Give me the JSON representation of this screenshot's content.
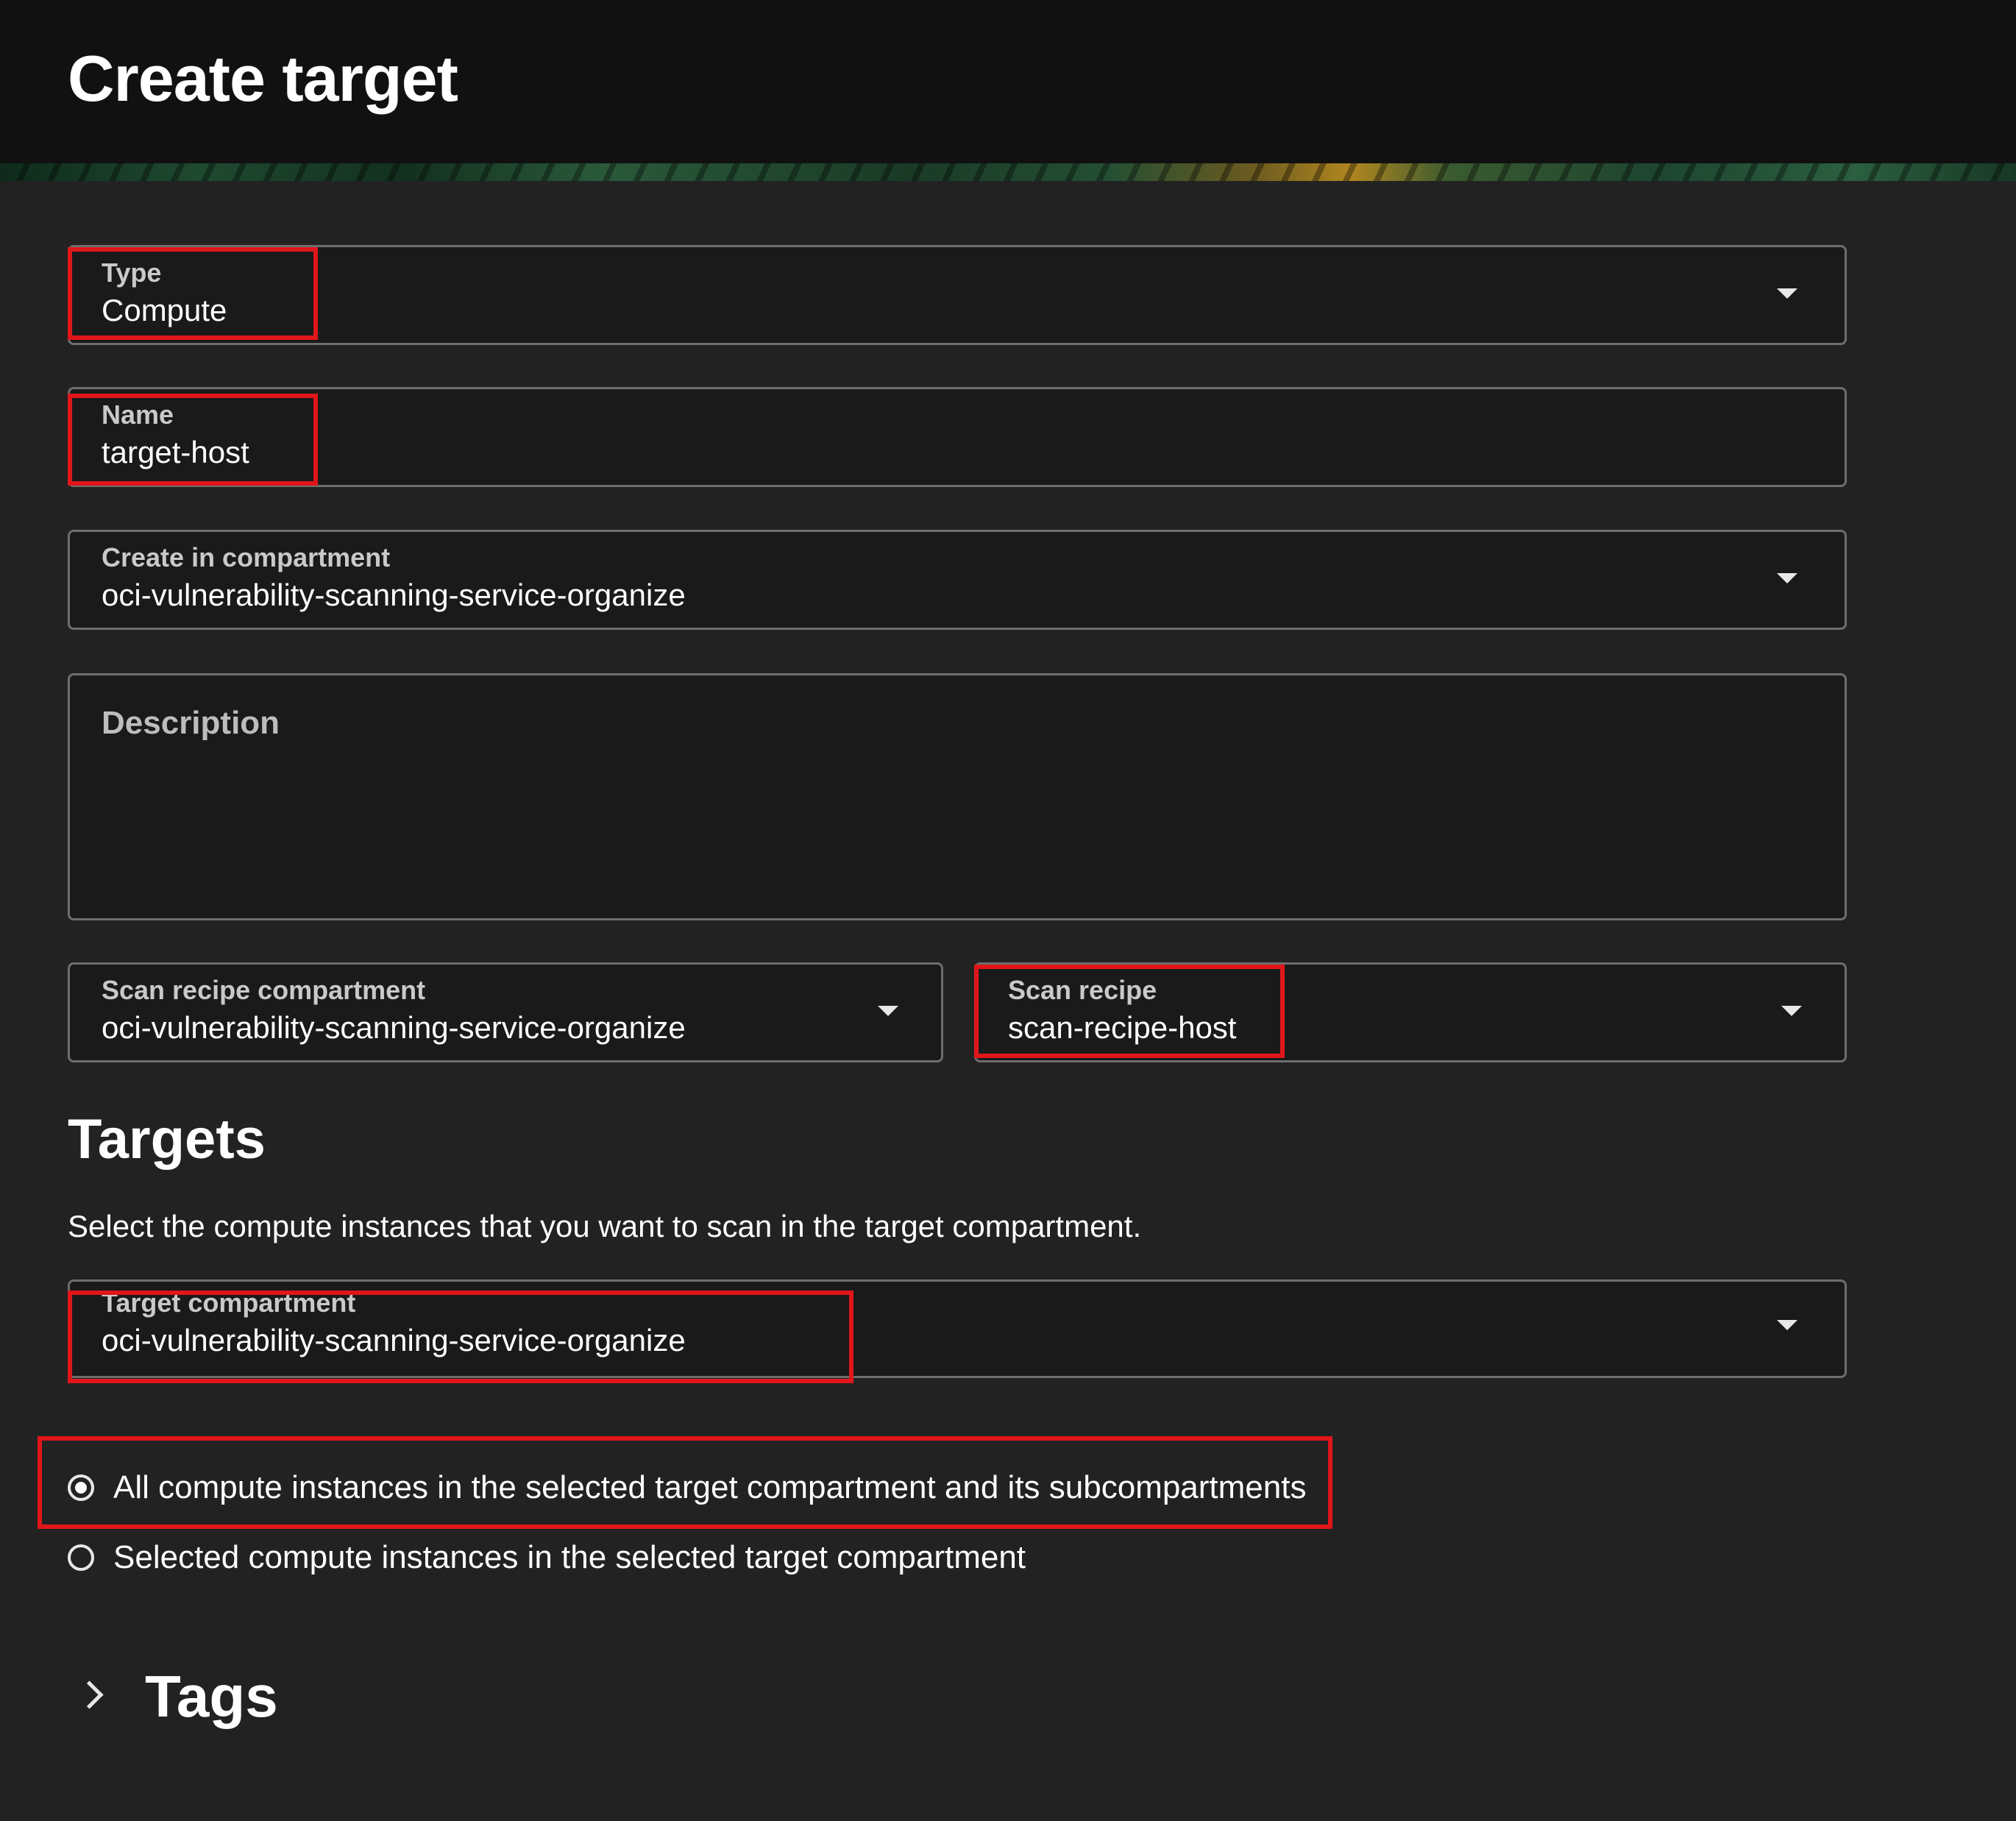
{
  "page": {
    "title": "Create target"
  },
  "form": {
    "type": {
      "label": "Type",
      "value": "Compute"
    },
    "name": {
      "label": "Name",
      "value": "target-host"
    },
    "compartment": {
      "label": "Create in compartment",
      "value": "oci-vulnerability-scanning-service-organize"
    },
    "description": {
      "label": "Description",
      "value": ""
    },
    "scan_recipe_compartment": {
      "label": "Scan recipe compartment",
      "value": "oci-vulnerability-scanning-service-organize"
    },
    "scan_recipe": {
      "label": "Scan recipe",
      "value": "scan-recipe-host"
    }
  },
  "targets": {
    "title": "Targets",
    "help": "Select the compute instances that you want to scan in the target compartment.",
    "target_compartment": {
      "label": "Target compartment",
      "value": "oci-vulnerability-scanning-service-organize"
    },
    "options": [
      {
        "label": "All compute instances in the selected target compartment and its subcompartments",
        "selected": true
      },
      {
        "label": "Selected compute instances in the selected target compartment",
        "selected": false
      }
    ]
  },
  "tags": {
    "title": "Tags"
  },
  "colors": {
    "background": "#222222",
    "header": "#111111",
    "highlight": "#e0161b",
    "field_border": "#6e6e6e"
  },
  "icons": {
    "dropdown": "caret-down-icon",
    "expand": "chevron-right-icon"
  }
}
